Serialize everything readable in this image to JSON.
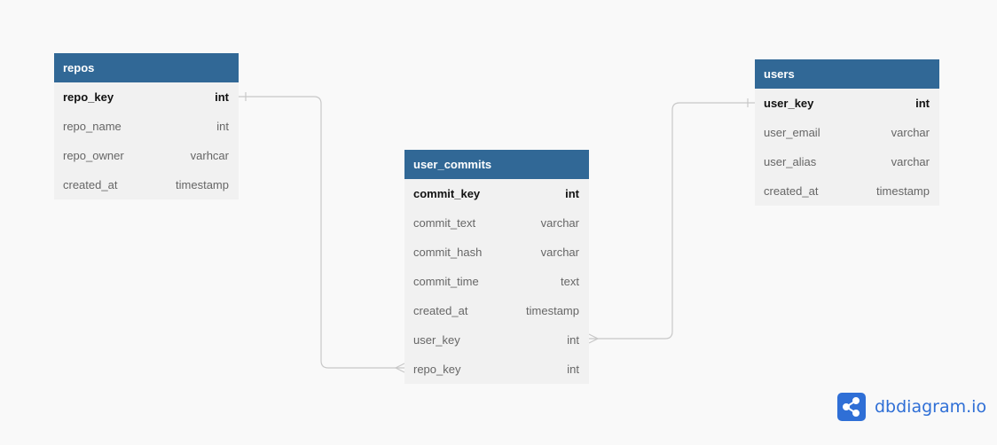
{
  "tables": {
    "repos": {
      "name": "repos",
      "columns": [
        {
          "name": "repo_key",
          "type": "int",
          "pk": true
        },
        {
          "name": "repo_name",
          "type": "int"
        },
        {
          "name": "repo_owner",
          "type": "varhcar"
        },
        {
          "name": "created_at",
          "type": "timestamp"
        }
      ]
    },
    "user_commits": {
      "name": "user_commits",
      "columns": [
        {
          "name": "commit_key",
          "type": "int",
          "pk": true
        },
        {
          "name": "commit_text",
          "type": "varchar"
        },
        {
          "name": "commit_hash",
          "type": "varchar"
        },
        {
          "name": "commit_time",
          "type": "text"
        },
        {
          "name": "created_at",
          "type": "timestamp"
        },
        {
          "name": "user_key",
          "type": "int"
        },
        {
          "name": "repo_key",
          "type": "int"
        }
      ]
    },
    "users": {
      "name": "users",
      "columns": [
        {
          "name": "user_key",
          "type": "int",
          "pk": true
        },
        {
          "name": "user_email",
          "type": "varchar"
        },
        {
          "name": "user_alias",
          "type": "varchar"
        },
        {
          "name": "created_at",
          "type": "timestamp"
        }
      ]
    }
  },
  "relationships": [
    {
      "from": "repos.repo_key",
      "to": "user_commits.repo_key",
      "type": "one-to-many"
    },
    {
      "from": "users.user_key",
      "to": "user_commits.user_key",
      "type": "one-to-many"
    }
  ],
  "logo": {
    "text": "dbdiagram.io",
    "icon": "share-nodes-icon"
  },
  "colors": {
    "header": "#316896",
    "brand": "#2f6fd6"
  }
}
